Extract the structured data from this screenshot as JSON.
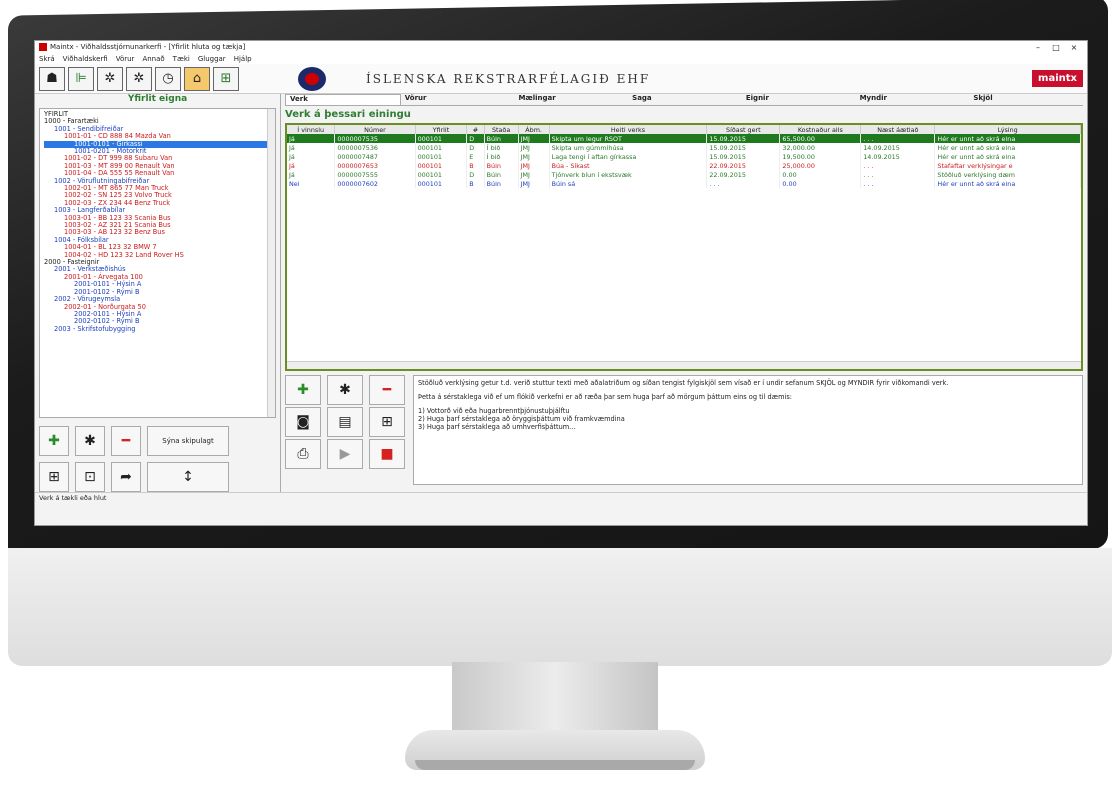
{
  "window": {
    "title": "Maintx - Viðhaldsstjórnunarkerfi - [Yfirlit hluta og tækja]",
    "minimize": "–",
    "maximize": "□",
    "close": "×"
  },
  "menu": [
    "Skrá",
    "Viðhaldskerfi",
    "Vörur",
    "Annað",
    "Tæki",
    "Gluggar",
    "Hjálp"
  ],
  "header": {
    "company": "ÍSLENSKA REKSTRARFÉLAGIÐ EHF",
    "brand": "maintx"
  },
  "tree": {
    "title": "Yfirlit eigna",
    "items": [
      {
        "text": "YFIRLIT",
        "indent": 0,
        "color": "black"
      },
      {
        "text": "1000 - Farartæki",
        "indent": 0,
        "color": "black"
      },
      {
        "text": "1001 - Sendibifreiðar",
        "indent": 1,
        "color": "blue"
      },
      {
        "text": "1001-01 - CD 888 84 Mazda Van",
        "indent": 2,
        "color": "red"
      },
      {
        "text": "1001-0101 - Girkassi",
        "indent": 3,
        "color": "sel"
      },
      {
        "text": "1001-0201 - Mótorkrít",
        "indent": 3,
        "color": "blue"
      },
      {
        "text": "1001-02 - DT 999 88 Subaru Van",
        "indent": 2,
        "color": "red"
      },
      {
        "text": "1001-03 - MT 899 00 Renault Van",
        "indent": 2,
        "color": "red"
      },
      {
        "text": "1001-04 - DA 555 55 Renault Van",
        "indent": 2,
        "color": "red"
      },
      {
        "text": "1002 - Vöruflutningabifreiðar",
        "indent": 1,
        "color": "blue"
      },
      {
        "text": "1002-01 - MT 865 77 Man Truck",
        "indent": 2,
        "color": "red"
      },
      {
        "text": "1002-02 - SN 125 23 Volvo Truck",
        "indent": 2,
        "color": "red"
      },
      {
        "text": "1002-03 - ZX 234 44 Benz Truck",
        "indent": 2,
        "color": "red"
      },
      {
        "text": "1003 - Langferðabílar",
        "indent": 1,
        "color": "blue"
      },
      {
        "text": "1003-01 - BB 123 33 Scania Bus",
        "indent": 2,
        "color": "red"
      },
      {
        "text": "1003-02 - AZ 321 21 Scania Bus",
        "indent": 2,
        "color": "red"
      },
      {
        "text": "1003-03 - AB 123 32 Benz Bus",
        "indent": 2,
        "color": "red"
      },
      {
        "text": "1004 - Fólksbílar",
        "indent": 1,
        "color": "blue"
      },
      {
        "text": "1004-01 - BL 123 32 BMW 7",
        "indent": 2,
        "color": "red"
      },
      {
        "text": "1004-02 - HD 123 32 Land Rover HS",
        "indent": 2,
        "color": "red"
      },
      {
        "text": "2000 - Fasteignir",
        "indent": 0,
        "color": "black"
      },
      {
        "text": "2001 - Verkstæðishús",
        "indent": 1,
        "color": "blue"
      },
      {
        "text": "2001-01 - Árvegata 100",
        "indent": 2,
        "color": "red"
      },
      {
        "text": "2001-0101 - Hýsin A",
        "indent": 3,
        "color": "blue"
      },
      {
        "text": "2001-0102 - Rými B",
        "indent": 3,
        "color": "blue"
      },
      {
        "text": "2002 - Vörugeymsla",
        "indent": 1,
        "color": "blue"
      },
      {
        "text": "2002-01 - Norðurgata 50",
        "indent": 2,
        "color": "red"
      },
      {
        "text": "2002-0101 - Hýsin A",
        "indent": 3,
        "color": "blue"
      },
      {
        "text": "2002-0102 - Rými B",
        "indent": 3,
        "color": "blue"
      },
      {
        "text": "2003 - Skrifstofubygging",
        "indent": 1,
        "color": "blue"
      }
    ]
  },
  "left_buttons": {
    "show_all": "Sýna skipulagt"
  },
  "tabs": [
    "Verk",
    "Vörur",
    "Mælingar",
    "Saga",
    "Eignir",
    "Myndir",
    "Skjöl"
  ],
  "section_title": "Verk á þessari einingu",
  "grid": {
    "columns": [
      "Í vinnslu",
      "Númer",
      "Yfirlit",
      "#",
      "Staða",
      "Ábm.",
      "Heiti verks",
      "Síðast gert",
      "Kostnaður alls",
      "Næst áætlað",
      "Lýsing"
    ],
    "rows": [
      {
        "style": "sel",
        "cells": [
          "Já",
          "0000007535",
          "000101",
          "D",
          "Búin",
          "JMJ",
          "Skipta um legur RSOT",
          "15.09.2015",
          "65,500.00",
          ". . .",
          "Hér er unnt að skrá eina"
        ]
      },
      {
        "style": "g",
        "cells": [
          "Já",
          "0000007536",
          "000101",
          "D",
          "Í bið",
          "JMJ",
          "Skipta um gúmmíhúsa",
          "15.09.2015",
          "32,000.00",
          "14.09.2015",
          "Hér er unnt að skrá eina"
        ]
      },
      {
        "style": "g",
        "cells": [
          "Já",
          "0000007487",
          "000101",
          "E",
          "Í bið",
          "JMJ",
          "Laga tengi í aftan gírkassa",
          "15.09.2015",
          "19,500.00",
          "14.09.2015",
          "Hér er unnt að skrá eina"
        ]
      },
      {
        "style": "r",
        "cells": [
          "Já",
          "0000007653",
          "000101",
          "B",
          "Búin",
          "JMJ",
          "Búa - Síkast",
          "22.09.2015",
          "25,000.00",
          ". . .",
          "Stafaftar verklýsingar e"
        ]
      },
      {
        "style": "g",
        "cells": [
          "Já",
          "0000007555",
          "000101",
          "D",
          "Búin",
          "JMJ",
          "Tjónverk bíun í ekstsvæk",
          "22.09.2015",
          "0.00",
          ". . .",
          "Stöðluð verklýsing dæm"
        ]
      },
      {
        "style": "b",
        "cells": [
          "Nei",
          "0000007602",
          "000101",
          "B",
          "Búin",
          "JMJ",
          "Búin sá",
          ". . .",
          "0.00",
          ". . .",
          "Hér er unnt að skrá eina"
        ]
      }
    ]
  },
  "notes": {
    "p1": "Stöðluð verklýsing getur t.d. verið stuttur texti með aðalatriðum og síðan tengist fylgiskjöl sem vísað er í undir sefanum SKJÖL og MYNDIR fyrir viðkomandi verk.",
    "p2": "Þetta á sérstaklega við ef um flókið verkefni er að ræða þar sem huga þarf að mörgum þáttum eins og til dæmis:",
    "l1": "1) Vottorð við eða hugarbrenntþjónustuþjálftu",
    "l2": "2) Huga þarf sérstaklega að öryggisþáttum við framkvæmdina",
    "l3": "3) Huga þarf sérstaklega að umhverfisþáttum..."
  },
  "status": "Verk á tækli eða hlut"
}
